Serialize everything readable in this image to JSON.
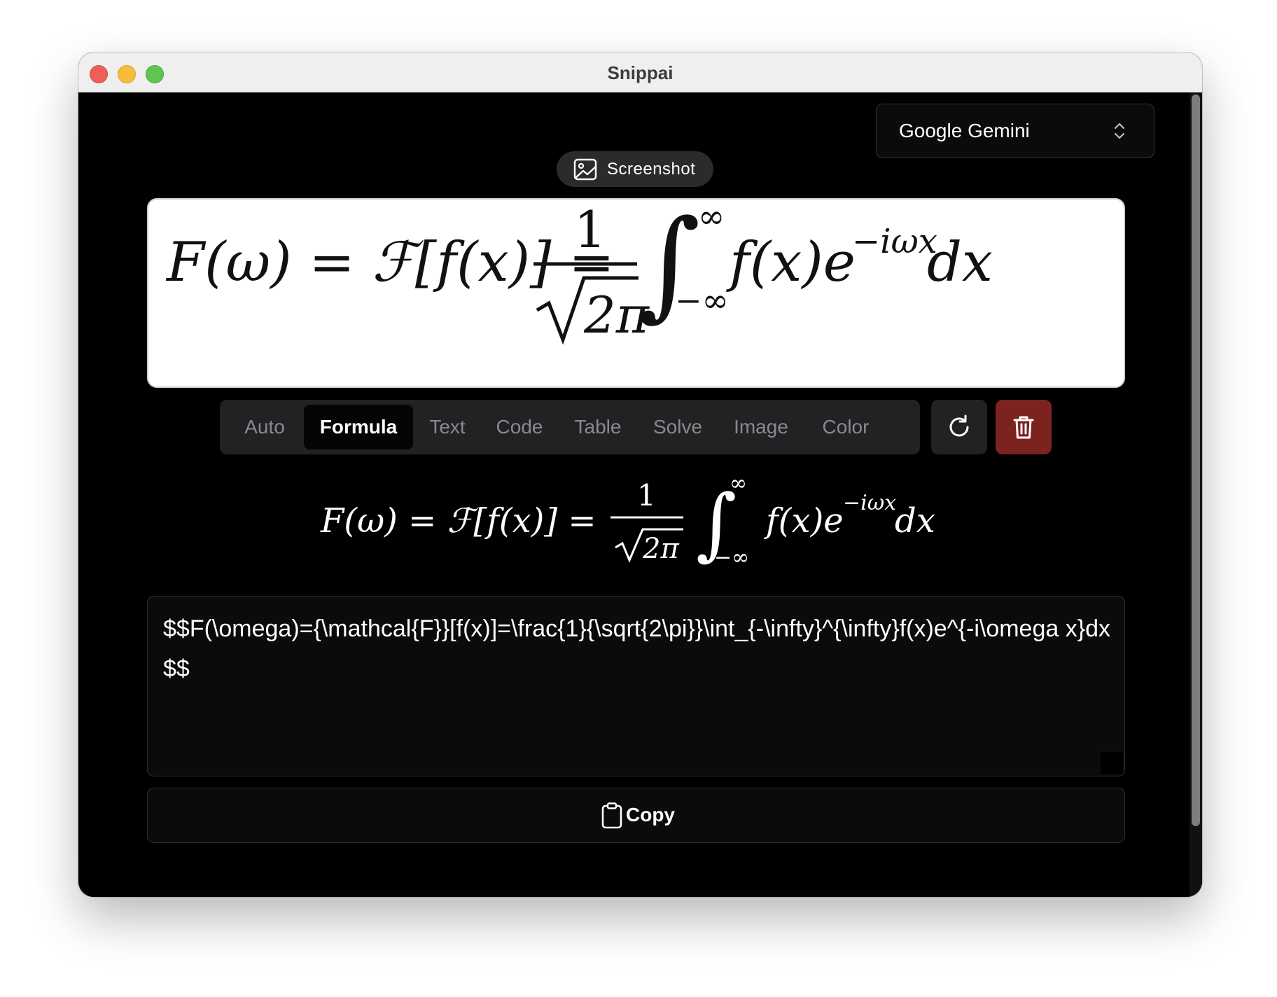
{
  "window": {
    "title": "Snippai"
  },
  "model_select": {
    "value": "Google Gemini"
  },
  "screenshot_button": {
    "label": "Screenshot"
  },
  "tabs": [
    {
      "label": "Auto",
      "active": false
    },
    {
      "label": "Formula",
      "active": true
    },
    {
      "label": "Text",
      "active": false
    },
    {
      "label": "Code",
      "active": false
    },
    {
      "label": "Table",
      "active": false
    },
    {
      "label": "Solve",
      "active": false
    },
    {
      "label": "Image",
      "active": false
    },
    {
      "label": "Color",
      "active": false
    }
  ],
  "formula": {
    "lhs": "F(ω) = ℱ[f(x)] =",
    "numerator": "1",
    "denominator": "2π",
    "upper_limit": "∞",
    "lower_limit": "−∞",
    "integrand": "f(x)e",
    "exponent": "−iωx",
    "differential": "dx"
  },
  "latex_output": {
    "value": "$$F(\\omega)={\\mathcal{F}}[f(x)]=\\frac{1}{\\sqrt{2\\pi}}\\int_{-\\infty}^{\\infty}f(x)e^{-i\\omega x}dx$$"
  },
  "copy_button": {
    "label": "Copy"
  },
  "colors": {
    "background": "#000000",
    "delete_button": "#7c2320",
    "tab_bar": "#222224"
  }
}
